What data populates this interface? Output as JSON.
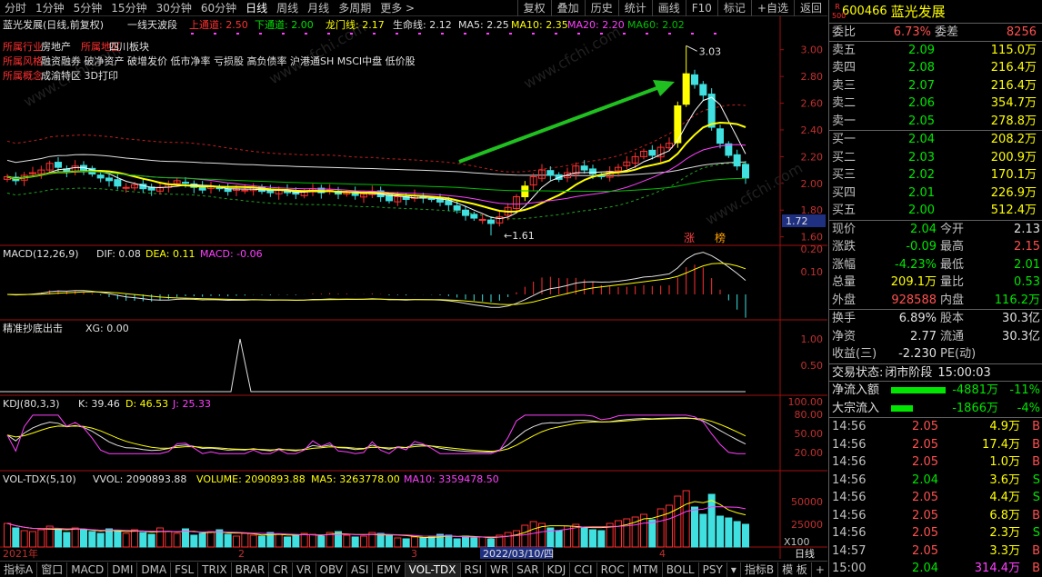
{
  "toolbar": {
    "periods": [
      "分时",
      "1分钟",
      "5分钟",
      "15分钟",
      "30分钟",
      "60分钟",
      "日线",
      "周线",
      "月线",
      "多周期",
      "更多 >"
    ],
    "active_period": "日线",
    "buttons": [
      "复权",
      "叠加",
      "历史",
      "统计",
      "画线",
      "F10",
      "标记",
      "+自选",
      "返回"
    ]
  },
  "main_header": {
    "title": "蓝光发展(日线,前复权)",
    "indicator": "一线天波段",
    "upper_channel_label": "上通道: 2.50",
    "lower_channel_label": "下通道: 2.00",
    "dragon_label": "龙门线: 2.17",
    "life_label": "生命线: 2.12",
    "ma5_label": "MA5: 2.25",
    "ma10_label": "MA10: 2.35",
    "ma20_label": "MA20: 2.20",
    "ma60_label": "MA60: 2.02"
  },
  "info_lines": {
    "industry_label": "所属行业",
    "industry_value": "房地产",
    "region_label": "所属地区",
    "region_value": "四川板块",
    "style_label": "所属风格",
    "style_value": "融资融券 破净资产 破增发价 低市净率 亏损股 高负债率 沪港通SH MSCI中盘 低价股",
    "concept_label": "所属概念",
    "concept_value": "成渝特区 3D打印"
  },
  "annotations": {
    "high_label": "3.03",
    "low_label": "1.61",
    "zhang": "涨",
    "bang": "榜",
    "price_tag": "1.72",
    "watermark": "www.cfchi.com"
  },
  "macd_header": {
    "name": "MACD(12,26,9)",
    "dif": "DIF: 0.08",
    "dea": "DEA: 0.11",
    "macd": "MACD: -0.06"
  },
  "xg_header": {
    "name": "精准抄底出击",
    "xg": "XG: 0.00"
  },
  "kdj_header": {
    "name": "KDJ(80,3,3)",
    "k": "K: 39.46",
    "d": "D: 46.53",
    "j": "J: 25.33"
  },
  "vol_header": {
    "name": "VOL-TDX(5,10)",
    "vvol": "VVOL: 2090893.88",
    "volume": "VOLUME: 2090893.88",
    "ma5": "MA5: 3263778.00",
    "ma10": "MA10: 3359478.50"
  },
  "axis_labels": {
    "price": [
      "3.00",
      "2.80",
      "2.60",
      "2.40",
      "2.20",
      "2.00",
      "1.80",
      "1.60"
    ],
    "macd": [
      "0.20",
      "0.10"
    ],
    "xg": [
      "1.00",
      "0.50"
    ],
    "kdj": [
      "100.00",
      "80.00",
      "50.00",
      "20.00"
    ],
    "vol": [
      "50000",
      "25000"
    ],
    "vol_unit": "X100"
  },
  "x_axis": {
    "labels": [
      "2021年",
      "2",
      "3",
      "4"
    ],
    "cursor_date": "2022/03/10/四",
    "period_tag": "日线"
  },
  "bottom_indicators": [
    "指标A",
    "窗口",
    "MACD",
    "DMI",
    "DMA",
    "FSL",
    "TRIX",
    "BRAR",
    "CR",
    "VR",
    "OBV",
    "ASI",
    "EMV",
    "VOL-TDX",
    "RSI",
    "WR",
    "SAR",
    "KDJ",
    "CCI",
    "ROC",
    "MTM",
    "BOLL",
    "PSY",
    "▾",
    "指标B",
    "模 板",
    "+",
    "-"
  ],
  "active_indicator": "VOL-TDX",
  "right_panel": {
    "code": "600466",
    "name": "蓝光发展",
    "logo": "R 500",
    "weibi_label": "委比",
    "weibi": "6.73%",
    "weicha_label": "委差",
    "weicha": "8256",
    "asks": [
      {
        "label": "卖五",
        "price": "2.09",
        "qty": "115.0万"
      },
      {
        "label": "卖四",
        "price": "2.08",
        "qty": "216.4万"
      },
      {
        "label": "卖三",
        "price": "2.07",
        "qty": "216.4万"
      },
      {
        "label": "卖二",
        "price": "2.06",
        "qty": "354.7万"
      },
      {
        "label": "卖一",
        "price": "2.05",
        "qty": "278.8万"
      }
    ],
    "bids": [
      {
        "label": "买一",
        "price": "2.04",
        "qty": "208.2万"
      },
      {
        "label": "买二",
        "price": "2.03",
        "qty": "200.9万"
      },
      {
        "label": "买三",
        "price": "2.02",
        "qty": "170.1万"
      },
      {
        "label": "买四",
        "price": "2.01",
        "qty": "226.9万"
      },
      {
        "label": "买五",
        "price": "2.00",
        "qty": "512.4万"
      }
    ],
    "quote": [
      {
        "l1": "现价",
        "v1": "2.04",
        "l2": "今开",
        "v2": "2.13"
      },
      {
        "l1": "涨跌",
        "v1": "-0.09",
        "l2": "最高",
        "v2": "2.15"
      },
      {
        "l1": "涨幅",
        "v1": "-4.23%",
        "l2": "最低",
        "v2": "2.01"
      },
      {
        "l1": "总量",
        "v1": "209.1万",
        "l2": "量比",
        "v2": "0.53"
      },
      {
        "l1": "外盘",
        "v1": "928588",
        "l2": "内盘",
        "v2": "116.2万"
      }
    ],
    "fundamentals": [
      {
        "l1": "换手",
        "v1": "6.89%",
        "l2": "股本",
        "v2": "30.3亿"
      },
      {
        "l1": "净资",
        "v1": "2.77",
        "l2": "流通",
        "v2": "30.3亿"
      },
      {
        "l1": "收益(三)",
        "v1": "-2.230",
        "l2": "PE(动)",
        "v2": ""
      }
    ],
    "status_label": "交易状态:",
    "status_value": "闭市阶段",
    "status_time": "15:00:03",
    "flows": [
      {
        "label": "净流入额",
        "value": "-4881万",
        "pct": "-11%"
      },
      {
        "label": "大宗流入",
        "value": "-1866万",
        "pct": "-4%"
      }
    ],
    "ticks": [
      {
        "time": "14:56",
        "price": "2.05",
        "vol": "4.9万",
        "bs": "B"
      },
      {
        "time": "14:56",
        "price": "2.05",
        "vol": "17.4万",
        "bs": "B"
      },
      {
        "time": "14:56",
        "price": "2.05",
        "vol": "1.0万",
        "bs": "B"
      },
      {
        "time": "14:56",
        "price": "2.04",
        "vol": "3.6万",
        "bs": "S"
      },
      {
        "time": "14:56",
        "price": "2.05",
        "vol": "4.4万",
        "bs": "S"
      },
      {
        "time": "14:56",
        "price": "2.05",
        "vol": "6.8万",
        "bs": "B"
      },
      {
        "time": "14:56",
        "price": "2.05",
        "vol": "2.3万",
        "bs": "S"
      },
      {
        "time": "14:57",
        "price": "2.05",
        "vol": "3.3万",
        "bs": "B"
      },
      {
        "time": "15:00",
        "price": "2.04",
        "vol": "314.4万",
        "bs": "B"
      }
    ]
  },
  "chart_data": {
    "type": "candlestick",
    "ylim": [
      1.55,
      3.1
    ],
    "high": 3.03,
    "low": 1.61,
    "closes": [
      2.05,
      2.02,
      2.06,
      2.08,
      2.1,
      2.15,
      2.12,
      2.09,
      2.13,
      2.1,
      2.07,
      2.04,
      2.02,
      1.98,
      1.97,
      1.99,
      1.96,
      1.95,
      1.97,
      1.99,
      2.02,
      2.0,
      1.97,
      1.95,
      1.98,
      1.96,
      1.94,
      1.96,
      1.95,
      1.97,
      1.94,
      1.93,
      1.95,
      1.93,
      1.92,
      1.94,
      1.96,
      1.93,
      1.95,
      1.92,
      1.93,
      1.91,
      1.92,
      1.94,
      1.9,
      1.87,
      1.9,
      1.88,
      1.91,
      1.89,
      1.88,
      1.86,
      1.84,
      1.8,
      1.76,
      1.74,
      1.73,
      1.7,
      1.75,
      1.82,
      1.9,
      1.98,
      2.05,
      2.1,
      2.06,
      2.03,
      2.08,
      2.13,
      2.1,
      2.07,
      2.05,
      2.09,
      2.12,
      2.16,
      2.2,
      2.24,
      2.21,
      2.27,
      2.3,
      2.58,
      2.82,
      2.74,
      2.66,
      2.42,
      2.3,
      2.21,
      2.13,
      2.04
    ],
    "volumes": [
      26000,
      21000,
      18000,
      17000,
      19000,
      23000,
      20000,
      16000,
      21000,
      19000,
      17000,
      15000,
      20000,
      18000,
      15000,
      19000,
      16000,
      14000,
      21000,
      17000,
      15000,
      20000,
      13000,
      15000,
      17000,
      19000,
      14000,
      12000,
      15000,
      13000,
      12000,
      16000,
      14000,
      11000,
      13000,
      15000,
      14000,
      12000,
      16000,
      17000,
      13000,
      11000,
      12000,
      16000,
      15000,
      13000,
      10000,
      9000,
      11000,
      10000,
      12000,
      14000,
      13000,
      9000,
      12000,
      10000,
      11000,
      9000,
      13000,
      16000,
      18000,
      24000,
      28000,
      26000,
      21000,
      18000,
      23000,
      25000,
      22000,
      19000,
      18000,
      26000,
      29000,
      31000,
      33000,
      36000,
      30000,
      42000,
      46000,
      56000,
      62000,
      44000,
      36000,
      58000,
      34000,
      32000,
      28000,
      25000
    ],
    "series": [
      {
        "name": "MA5",
        "value": 2.25
      },
      {
        "name": "MA10",
        "value": 2.35
      },
      {
        "name": "MA20",
        "value": 2.2
      },
      {
        "name": "MA60",
        "value": 2.02
      }
    ]
  }
}
